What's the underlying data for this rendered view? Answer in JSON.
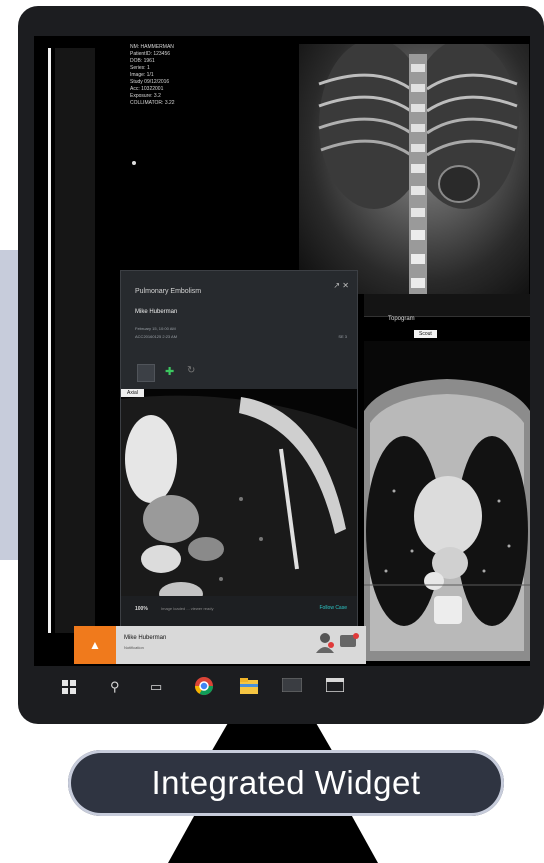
{
  "dicom_overlay": {
    "lines": [
      "NM: HAMMERMAN",
      "PatientID: 123456",
      "DOB: 1961",
      "Series: 1",
      "Image: 1/1",
      "Study 09/12/2016",
      "Acc: 10322001",
      "Exposure: 3.2",
      "COLLIMATOR: 3.22"
    ]
  },
  "ct_panel": {
    "tab_label": "Topogram",
    "image_label": "Scout"
  },
  "widget": {
    "title": "Pulmonary Embolism",
    "window_icons": "↗ ✕",
    "patient_name": "Mike Huberman",
    "meta_line_1": "February 15, 10:00 AM",
    "meta_line_2": "ACC20160125 2:23 AM",
    "series_label": "SE 3",
    "image_label": "Axial",
    "zoom": "100%",
    "status": "Image loaded ... viewer ready",
    "follow_label": "Follow Case"
  },
  "notification": {
    "badge": "▲",
    "name": "Mike Huberman",
    "subtitle": "Notification",
    "action_1_icon": "doctor-icon",
    "action_2_icon": "message-icon"
  },
  "taskbar": {
    "icons": [
      "windows-start-icon",
      "search-icon",
      "task-view-icon",
      "chrome-icon",
      "file-explorer-icon",
      "app-icon",
      "window-icon"
    ]
  },
  "caption": {
    "text": "Integrated Widget"
  },
  "colors": {
    "accent_orange": "#f07a1c",
    "caption_pill": "#2f3441",
    "monitor_frame": "#1c1d20",
    "follow_teal": "#2cc8c8"
  }
}
